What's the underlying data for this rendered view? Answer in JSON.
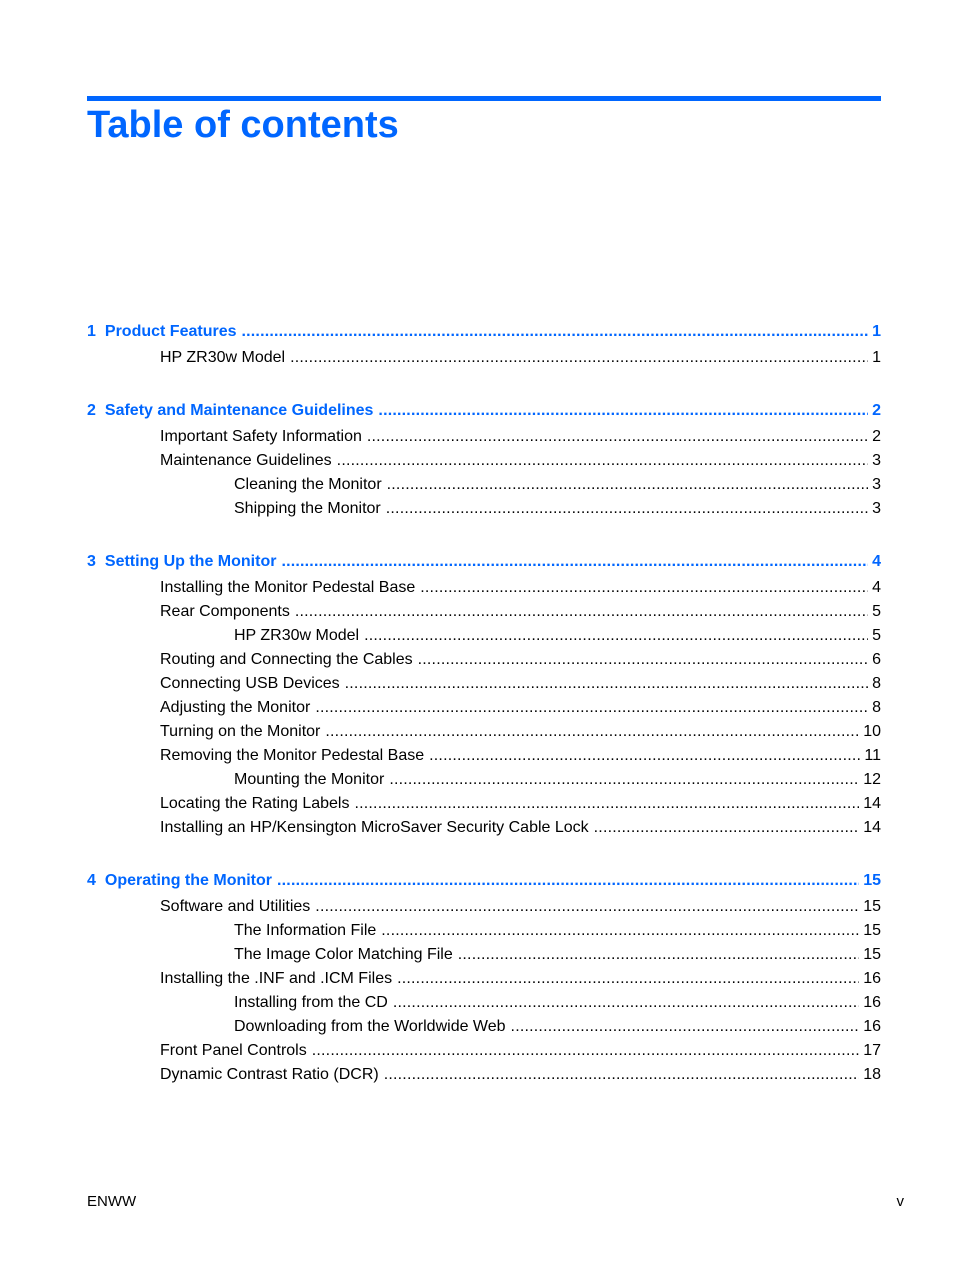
{
  "title": "Table of contents",
  "colors": {
    "accent": "#0066FF"
  },
  "chapters": [
    {
      "number": "1",
      "title": "Product Features",
      "page": "1",
      "entries": [
        {
          "level": 1,
          "title": "HP ZR30w Model",
          "page": "1"
        }
      ]
    },
    {
      "number": "2",
      "title": "Safety and Maintenance Guidelines",
      "page": "2",
      "entries": [
        {
          "level": 1,
          "title": "Important Safety Information",
          "page": "2"
        },
        {
          "level": 1,
          "title": "Maintenance Guidelines",
          "page": "3"
        },
        {
          "level": 2,
          "title": "Cleaning the Monitor",
          "page": "3"
        },
        {
          "level": 2,
          "title": "Shipping the Monitor",
          "page": "3"
        }
      ]
    },
    {
      "number": "3",
      "title": "Setting Up the Monitor",
      "page": "4",
      "entries": [
        {
          "level": 1,
          "title": "Installing the Monitor Pedestal Base",
          "page": "4"
        },
        {
          "level": 1,
          "title": "Rear Components",
          "page": "5"
        },
        {
          "level": 2,
          "title": "HP ZR30w Model",
          "page": "5"
        },
        {
          "level": 1,
          "title": "Routing and Connecting the Cables",
          "page": "6"
        },
        {
          "level": 1,
          "title": "Connecting USB Devices",
          "page": "8"
        },
        {
          "level": 1,
          "title": "Adjusting the Monitor",
          "page": "8"
        },
        {
          "level": 1,
          "title": "Turning on the Monitor",
          "page": "10"
        },
        {
          "level": 1,
          "title": "Removing the Monitor Pedestal Base",
          "page": "11"
        },
        {
          "level": 2,
          "title": "Mounting the Monitor",
          "page": "12"
        },
        {
          "level": 1,
          "title": "Locating the Rating Labels",
          "page": "14"
        },
        {
          "level": 1,
          "title": "Installing an HP/Kensington MicroSaver Security Cable Lock",
          "page": "14"
        }
      ]
    },
    {
      "number": "4",
      "title": "Operating the Monitor",
      "page": "15",
      "entries": [
        {
          "level": 1,
          "title": "Software and Utilities",
          "page": "15"
        },
        {
          "level": 2,
          "title": "The Information File",
          "page": "15"
        },
        {
          "level": 2,
          "title": "The Image Color Matching File",
          "page": "15"
        },
        {
          "level": 1,
          "title": "Installing the .INF and .ICM Files",
          "page": "16"
        },
        {
          "level": 2,
          "title": "Installing from the CD",
          "page": "16"
        },
        {
          "level": 2,
          "title": "Downloading from the Worldwide Web",
          "page": "16"
        },
        {
          "level": 1,
          "title": "Front Panel Controls",
          "page": "17"
        },
        {
          "level": 1,
          "title": "Dynamic Contrast Ratio (DCR)",
          "page": "18"
        }
      ]
    }
  ],
  "footer": {
    "left": "ENWW",
    "right": "v"
  }
}
